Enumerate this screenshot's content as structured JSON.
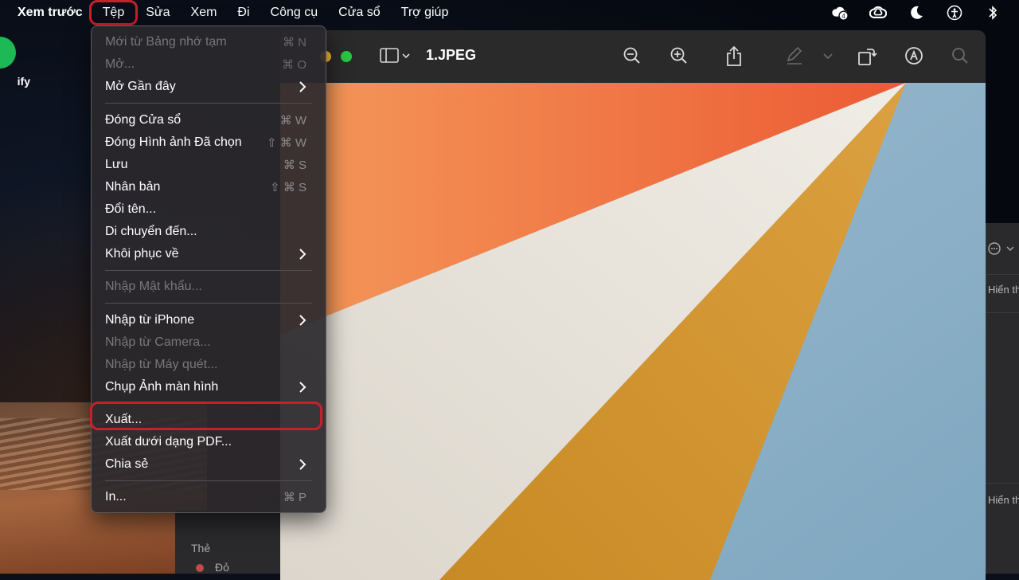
{
  "menubar": {
    "app_name": "Xem trước",
    "items": [
      "Tệp",
      "Sửa",
      "Xem",
      "Đi",
      "Công cụ",
      "Cửa sổ",
      "Trợ giúp"
    ],
    "notification_count": "4"
  },
  "desktop": {
    "app_label": "ify"
  },
  "window": {
    "title": "1.JPEG"
  },
  "inspector": {
    "label_top": "Hiển th",
    "label_bottom": "Hiển th"
  },
  "sidebar": {
    "section": "Thẻ",
    "tag_red": "Đỏ"
  },
  "file_menu": {
    "items": [
      {
        "label": "Mới từ Bảng nhớ tạm",
        "shortcut": "⌘ N",
        "disabled": true
      },
      {
        "label": "Mở...",
        "shortcut": "⌘ O",
        "disabled": true
      },
      {
        "label": "Mở Gần đây",
        "submenu": true
      },
      {
        "label": "Đóng Cửa sổ",
        "shortcut": "⌘ W"
      },
      {
        "label": "Đóng Hình ảnh Đã chọn",
        "shortcut": "⇧ ⌘ W"
      },
      {
        "label": "Lưu",
        "shortcut": "⌘ S"
      },
      {
        "label": "Nhân bản",
        "shortcut": "⇧ ⌘ S"
      },
      {
        "label": "Đổi tên..."
      },
      {
        "label": "Di chuyển đến..."
      },
      {
        "label": "Khôi phục về",
        "submenu": true
      },
      {
        "label": "Nhập Mật khẩu...",
        "disabled": true
      },
      {
        "label": "Nhập từ iPhone",
        "submenu": true
      },
      {
        "label": "Nhập từ Camera...",
        "disabled": true
      },
      {
        "label": "Nhập từ Máy quét...",
        "disabled": true
      },
      {
        "label": "Chụp Ảnh màn hình",
        "submenu": true
      },
      {
        "label": "Xuất..."
      },
      {
        "label": "Xuất dưới dạng PDF..."
      },
      {
        "label": "Chia sẻ",
        "submenu": true
      },
      {
        "label": "In...",
        "shortcut": "⌘ P"
      }
    ]
  },
  "colors": {
    "highlight": "#c8202b",
    "orange": "#f07a44",
    "cream": "#e8e4dc",
    "gold": "#d39a30",
    "blue": "#8db0c8"
  }
}
